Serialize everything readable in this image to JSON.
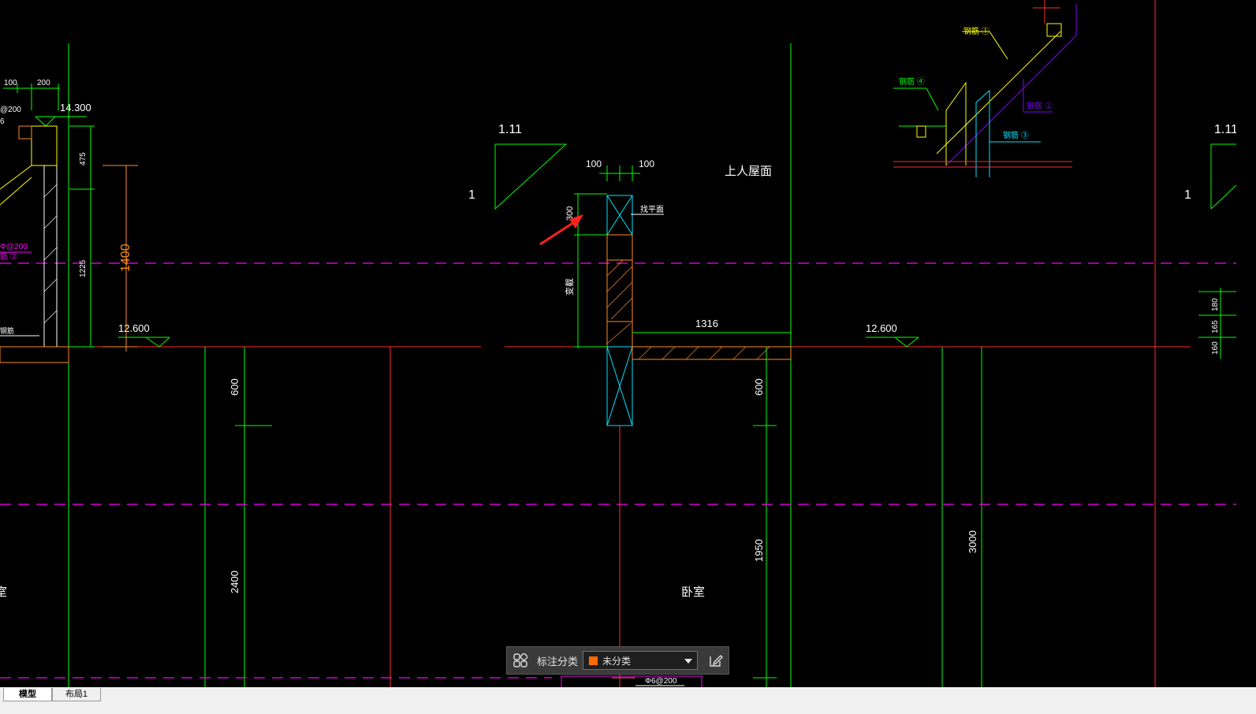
{
  "colors": {
    "background": "#000000",
    "green": "#00ff00",
    "cyan": "#00e5ff",
    "yellow": "#ffff00",
    "magenta": "#ff00ff",
    "red": "#ff2a2a",
    "orange": "#ff8c1a",
    "white": "#ffffff",
    "violet": "#8000ff",
    "arrow": "#ff2020",
    "category_swatch": "#ff6a00"
  },
  "drawing": {
    "slope_left_top": "1.11",
    "slope_left_side": "1",
    "slope_right_top": "1.11",
    "slope_right_side": "1",
    "dim_parapet_left": "100",
    "dim_parapet_right": "100",
    "dim_parapet_height": "300",
    "label_waterproof": "找平面",
    "label_left_vertical": "变截",
    "label_roof": "上人屋面",
    "dim_span": "1316",
    "elev_center_left": "12.600",
    "elev_center_right": "12.600",
    "dim_col1_upper": "600",
    "dim_col1_lower": "2400",
    "dim_col2_upper": "600",
    "dim_col2_lower": "1950",
    "dim_col3": "3000",
    "label_bedroom": "卧室",
    "label_bottom_rebar": "Φ6@200",
    "left_detail": {
      "dim_a": "100",
      "dim_b": "200",
      "elev_top": "14.300",
      "rebar_top": "@200",
      "rebar_top2": "6",
      "dim_475": "475",
      "dim_1225": "1225",
      "dim_1400": "1400",
      "rebar_mid": "Φ@200",
      "rebar_mid2": "筋 ②",
      "rebar_low": "钢筋",
      "room_partial": "室"
    },
    "rebar_detail": {
      "rebar_1": "钢筋 ①",
      "rebar_4": "钢筋 ④",
      "rebar_2": "钢筋 ②",
      "rebar_3": "钢筋 ③"
    },
    "right_edge": {
      "dim_180": "180",
      "dim_165": "165",
      "dim_160": "160"
    }
  },
  "annotation_toolbar": {
    "label": "标注分类",
    "category": "未分类"
  },
  "tabs": {
    "model": "模型",
    "layout1": "布局1"
  }
}
